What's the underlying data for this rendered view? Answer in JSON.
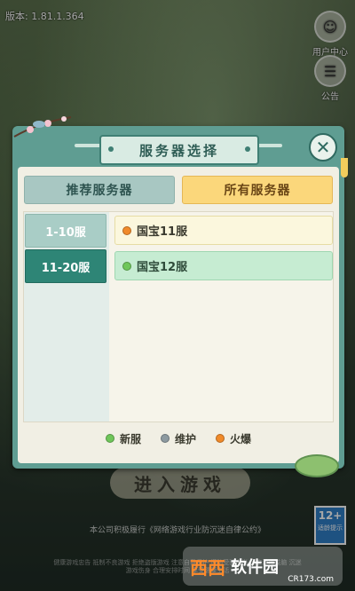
{
  "background": {
    "version_text": "版本: 1.81.1.364",
    "user_center_label": "用户中心",
    "notice_label": "公告",
    "enter_game_label": "进入游戏",
    "license_text": "本公司积极履行《网络游戏行业防沉迷自律公约》",
    "fine_print": "健康游戏忠告 抵制不良游戏 拒绝盗版游戏 注意自我保护 谨防受骗上当 适度游戏益脑 沉迷游戏伤身 合理安排时间 享受健康生活",
    "age_rating": "12+",
    "age_rating_sub": "适龄提示",
    "watermark_brand": "西西",
    "watermark_text": "软件园",
    "watermark_site": "CR173.com"
  },
  "dialog": {
    "title": "服务器选择",
    "tabs": [
      {
        "label": "推荐服务器",
        "selected": false
      },
      {
        "label": "所有服务器",
        "selected": true
      }
    ],
    "ranges": [
      {
        "label": "1-10服",
        "selected": false
      },
      {
        "label": "11-20服",
        "selected": true
      }
    ],
    "servers": [
      {
        "name": "国宝11服",
        "status": "hot",
        "status_color": "#f08a2a"
      },
      {
        "name": "国宝12服",
        "status": "new",
        "status_color": "#6fc65a"
      }
    ],
    "legend": [
      {
        "label": "新服",
        "color": "#6fc65a"
      },
      {
        "label": "维护",
        "color": "#8d9aa0"
      },
      {
        "label": "火爆",
        "color": "#f08a2a"
      }
    ]
  },
  "colors": {
    "accent_teal": "#2e8576",
    "tab_selected": "#fbd77b",
    "panel": "#f1efe4"
  }
}
